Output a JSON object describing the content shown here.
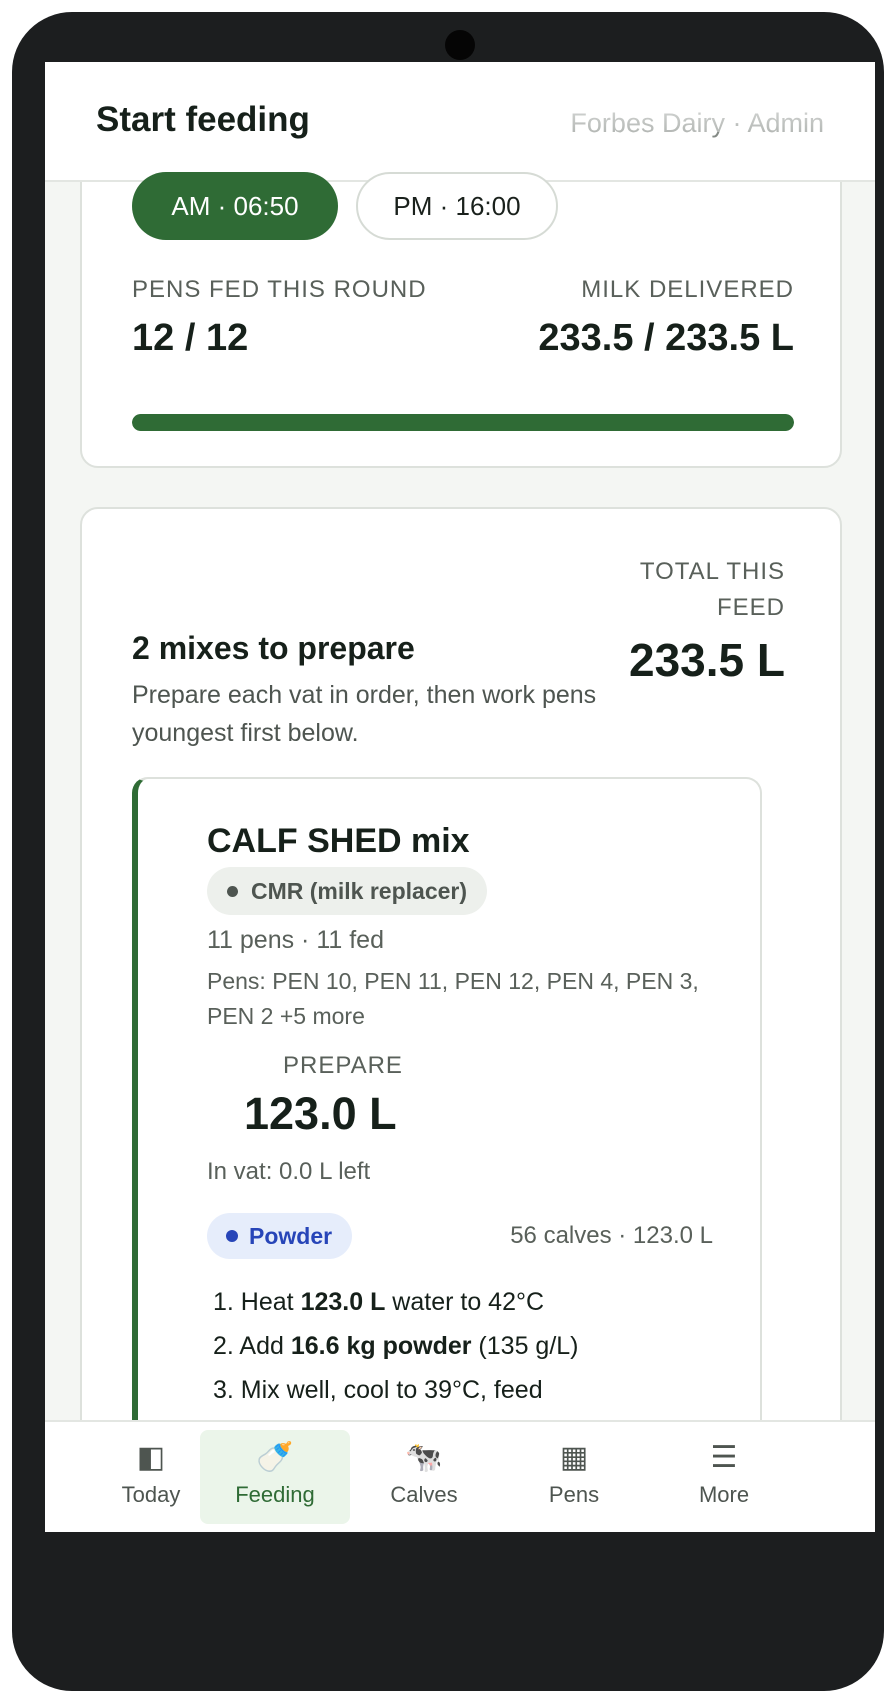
{
  "header": {
    "title": "Start feeding",
    "org": "Forbes Dairy · Admin"
  },
  "round": {
    "chips": [
      {
        "label": "AM · 06:50",
        "active": true
      },
      {
        "label": "PM · 16:00",
        "active": false
      }
    ],
    "pens_label": "PENS FED THIS ROUND",
    "pens_value": "12 / 12",
    "milk_label": "MILK DELIVERED",
    "milk_value": "233.5 / 233.5 L",
    "progress": 1.0
  },
  "mixes": {
    "title": "2 mixes to prepare",
    "description": "Prepare each vat in order, then work pens youngest first below.",
    "total_label": "TOTAL THIS FEED",
    "total_value": "233.5 L",
    "mix": {
      "title": "CALF SHED mix",
      "type": "CMR (milk replacer)",
      "pens_summary": "11 pens · 11 fed",
      "pens_list": "Pens: PEN 10, PEN 11, PEN 12, PEN 4, PEN 3, PEN 2 +5 more",
      "prepare_label": "PREPARE",
      "prepare_value": "123.0 L",
      "in_vat": "In vat: 0.0 L left",
      "form": "Powder",
      "calves_info": "56 calves · 123.0 L",
      "steps": [
        {
          "pre": "Heat ",
          "bold": "123.0 L",
          "post": " water to 42°C"
        },
        {
          "pre": "Add ",
          "bold": "16.6 kg powder",
          "post": " (135 g/L)"
        },
        {
          "pre": "Mix well, cool to 39°C, feed",
          "bold": "",
          "post": ""
        }
      ]
    }
  },
  "nav": [
    {
      "label": "Today",
      "icon": "sidebar-panel-icon",
      "glyph": "◧",
      "active": false
    },
    {
      "label": "Feeding",
      "icon": "baby-bottle-icon",
      "glyph": "🍼",
      "active": true
    },
    {
      "label": "Calves",
      "icon": "cow-icon",
      "glyph": "🐄",
      "active": false
    },
    {
      "label": "Pens",
      "icon": "grid-icon",
      "glyph": "▦",
      "active": false
    },
    {
      "label": "More",
      "icon": "menu-icon",
      "glyph": "☰",
      "active": false
    }
  ],
  "colors": {
    "accent": "#2f6b35",
    "powder": "#2745b8",
    "border": "#dde1dc"
  }
}
